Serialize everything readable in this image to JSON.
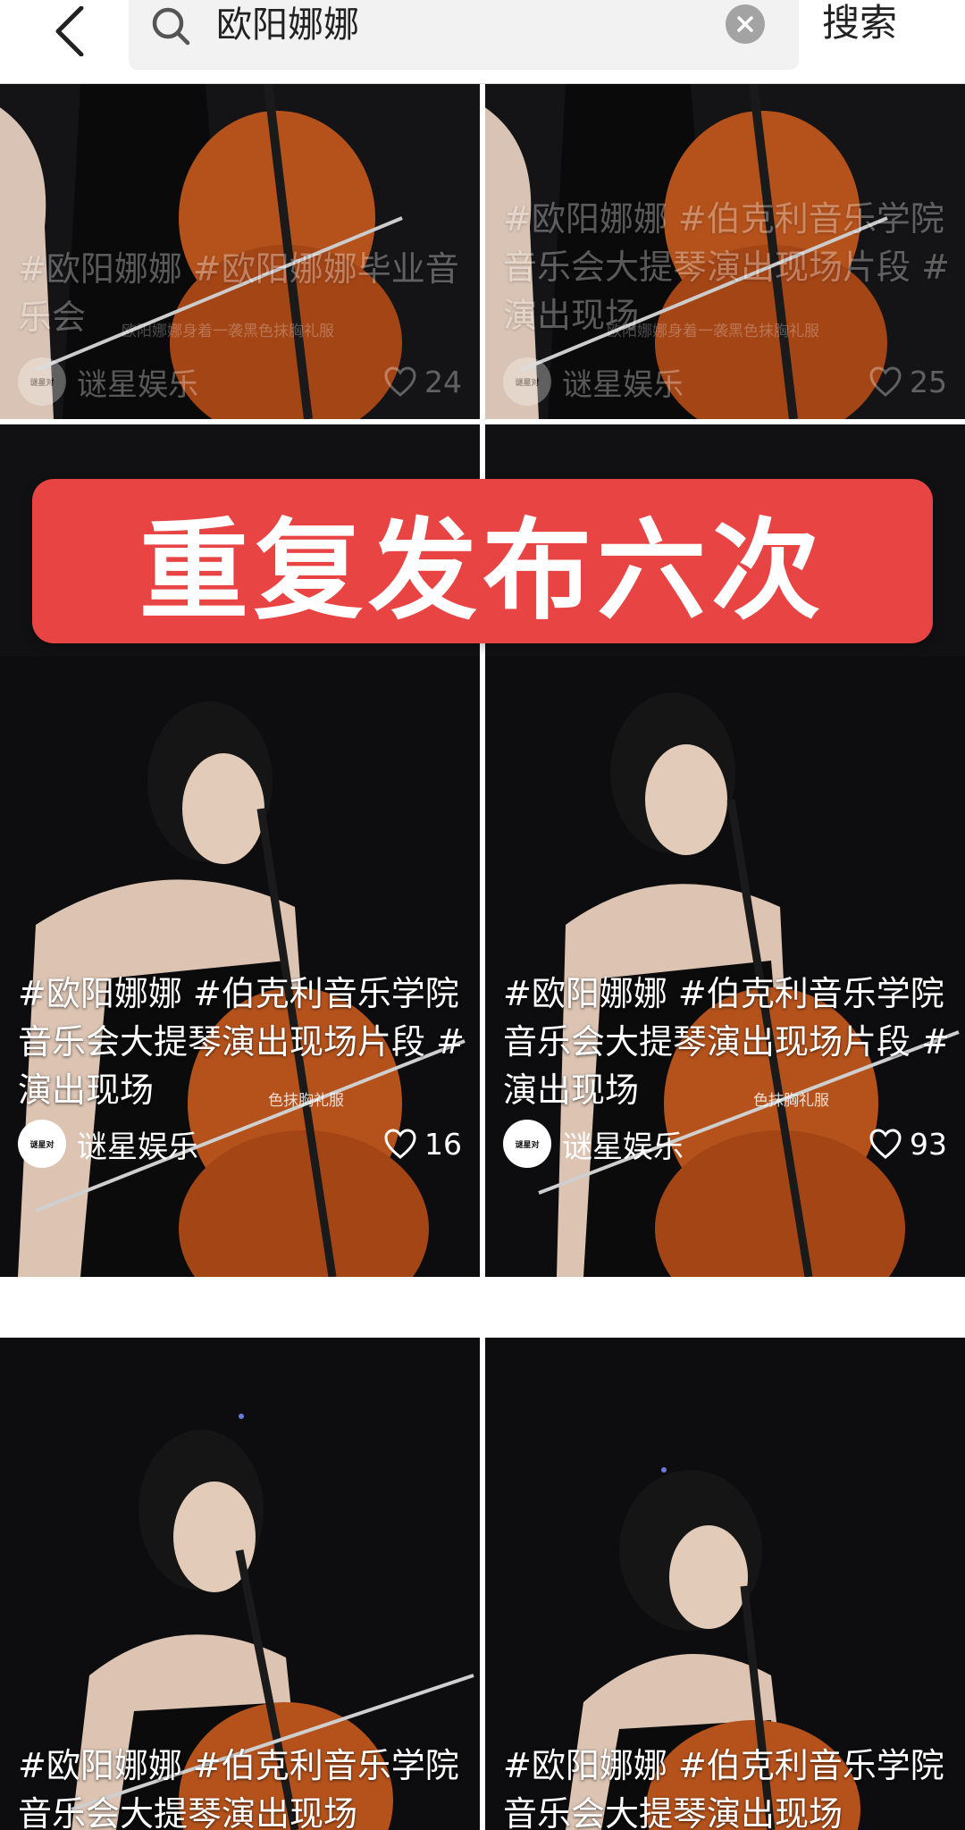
{
  "search": {
    "query": "欧阳娜娜",
    "submit_label": "搜索"
  },
  "icons": {
    "back": "chevron-left-icon",
    "search": "magnifier-icon",
    "clear": "close-circle-icon",
    "like": "heart-outline-icon"
  },
  "colors": {
    "banner": "#e94444",
    "card_background": "#0c0c0e",
    "cello": "#b5521c"
  },
  "banner": {
    "text": "重复发布六次"
  },
  "cards": [
    {
      "caption": "#欧阳娜娜 #欧阳娜娜毕业音乐会",
      "subtitle": "欧阳娜娜身着一袭黑色抹胸礼服",
      "author": "谜星娱乐",
      "avatar_text": "谜星对",
      "likes": "24"
    },
    {
      "caption": "#欧阳娜娜 #伯克利音乐学院 音乐会大提琴演出现场片段 #演出现场",
      "subtitle": "欧阳娜娜身着一袭黑色抹胸礼服",
      "author": "谜星娱乐",
      "avatar_text": "谜星对",
      "likes": "25"
    },
    {
      "caption": "#欧阳娜娜 #伯克利音乐学院 音乐会大提琴演出现场片段 #演出现场",
      "subtitle": "色抹胸礼服",
      "author": "谜星娱乐",
      "avatar_text": "谜星对",
      "likes": "16"
    },
    {
      "caption": "#欧阳娜娜 #伯克利音乐学院 音乐会大提琴演出现场片段 #演出现场",
      "subtitle": "色抹胸礼服",
      "author": "谜星娱乐",
      "avatar_text": "谜星对",
      "likes": "93"
    },
    {
      "caption": "#欧阳娜娜 #伯克利音乐学院 音乐会大提琴演出现场",
      "subtitle": "",
      "author": "",
      "avatar_text": "",
      "likes": ""
    },
    {
      "caption": "#欧阳娜娜 #伯克利音乐学院 音乐会大提琴演出现场",
      "subtitle": "",
      "author": "",
      "avatar_text": "",
      "likes": ""
    }
  ]
}
